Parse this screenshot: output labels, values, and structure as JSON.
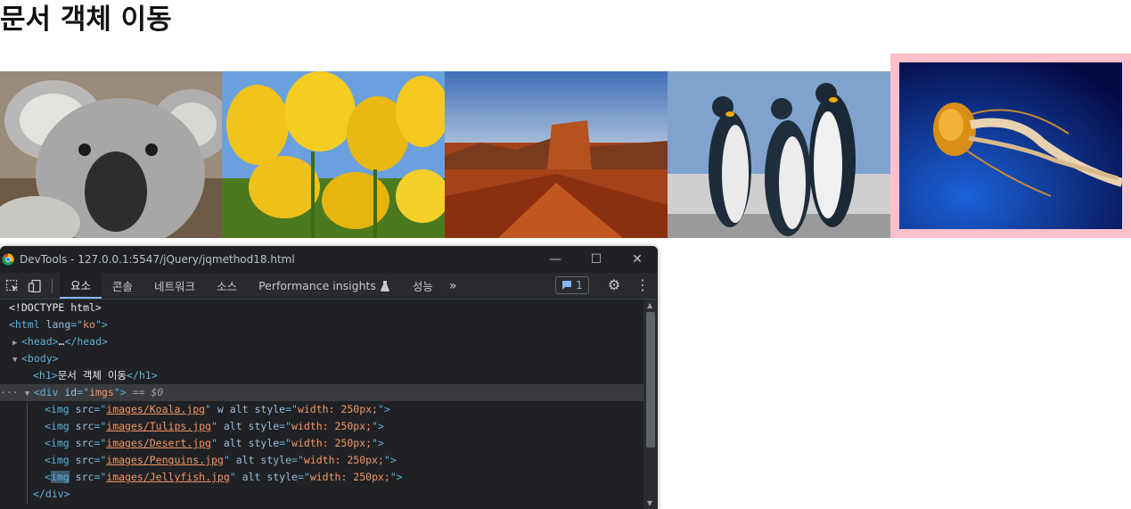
{
  "page": {
    "heading": "문서 객체 이동"
  },
  "images": [
    {
      "name": "Koala"
    },
    {
      "name": "Tulips"
    },
    {
      "name": "Desert"
    },
    {
      "name": "Penguins"
    },
    {
      "name": "Jellyfish",
      "selected_border_color": "#ffc0cb"
    }
  ],
  "devtools": {
    "title": "DevTools - 127.0.0.1:5547/jQuery/jqmethod18.html",
    "tabs": [
      "요소",
      "콘솔",
      "네트워크",
      "소스",
      "Performance insights",
      "성능"
    ],
    "active_tab": "요소",
    "more_tabs_label": "»",
    "message_count": "1",
    "window_buttons": {
      "minimize": "—",
      "maximize": "☐",
      "close": "✕"
    }
  },
  "dom_tree": {
    "doctype": "<!DOCTYPE html>",
    "html_lang": "ko",
    "h1_text": "문서 객체 이동",
    "div_id": "imgs",
    "selected_marker": "== $0",
    "imgs": [
      {
        "src": "images/Koala.jpg",
        "extra": " w alt ",
        "style": "width: 250px;"
      },
      {
        "src": "images/Tulips.jpg",
        "extra": " alt ",
        "style": "width: 250px;"
      },
      {
        "src": "images/Desert.jpg",
        "extra": " alt ",
        "style": "width: 250px;"
      },
      {
        "src": "images/Penguins.jpg",
        "extra": " alt ",
        "style": "width: 250px;"
      },
      {
        "src": "images/Jellyfish.jpg",
        "extra": " alt ",
        "style": "width: 250px;"
      }
    ]
  }
}
